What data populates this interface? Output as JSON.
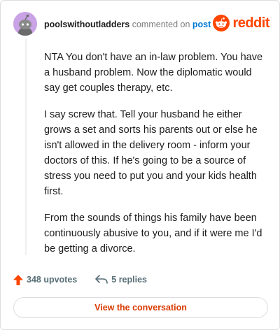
{
  "header": {
    "username": "poolswithoutladders",
    "commented_text": "commented on",
    "post_link": "post",
    "brand": "reddit",
    "avatar_icon": "snoo-avatar-icon",
    "logo_icon": "reddit-logo-icon"
  },
  "comment": {
    "paragraphs": [
      "NTA You don't have an in-law problem. You have a husband problem. Now the diplomatic would say get couples therapy, etc.",
      "I say screw that. Tell your husband he either grows a set and sorts his parents out or else he isn't allowed in the delivery room - inform your doctors of this. If he's going to be a source of stress you need to put you and your kids health first.",
      "From the sounds of things his family have been continuously abusive to you, and if it were me I'd be getting a divorce."
    ]
  },
  "stats": {
    "upvotes": "348 upvotes",
    "replies": "5 replies",
    "upvote_icon": "upvote-arrow-icon",
    "reply_icon": "reply-arrow-icon"
  },
  "cta": {
    "label": "View the conversation"
  },
  "colors": {
    "brand": "#ff4500",
    "link": "#0079d3",
    "avatar_bg": "#c9a3e6",
    "cta_text": "#d93900"
  }
}
